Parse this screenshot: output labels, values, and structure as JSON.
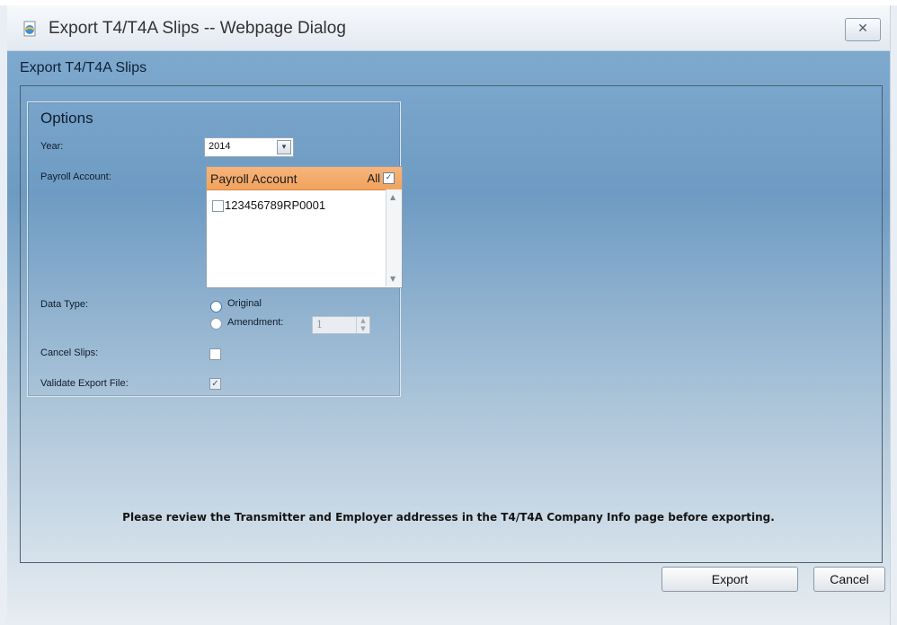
{
  "window": {
    "title": "Export T4/T4A Slips -- Webpage Dialog",
    "close_label": "✕"
  },
  "page": {
    "heading": "Export T4/T4A Slips"
  },
  "options": {
    "title": "Options",
    "year_label": "Year:",
    "year_value": "2014",
    "payroll_account_label": "Payroll Account:",
    "grid": {
      "header": "Payroll Account",
      "all_label": "All",
      "all_checked": true,
      "accounts": [
        {
          "number": "123456789RP0001",
          "checked": false
        }
      ]
    },
    "data_type_label": "Data Type:",
    "data_type_options": [
      "Original",
      "Amendment:"
    ],
    "data_type_selected": "Original",
    "amendment_value": "1",
    "cancel_slips_label": "Cancel Slips:",
    "cancel_slips_checked": false,
    "validate_label": "Validate Export File:",
    "validate_checked": true
  },
  "notice": "Please review the Transmitter and Employer addresses in the T4/T4A Company Info page before exporting.",
  "buttons": {
    "export": "Export",
    "cancel": "Cancel"
  },
  "icons": {
    "window_icon": "ie-page-icon",
    "select_arrow": "chevron-down-icon",
    "scroll_up": "scroll-up-icon",
    "scroll_down": "scroll-down-icon"
  }
}
